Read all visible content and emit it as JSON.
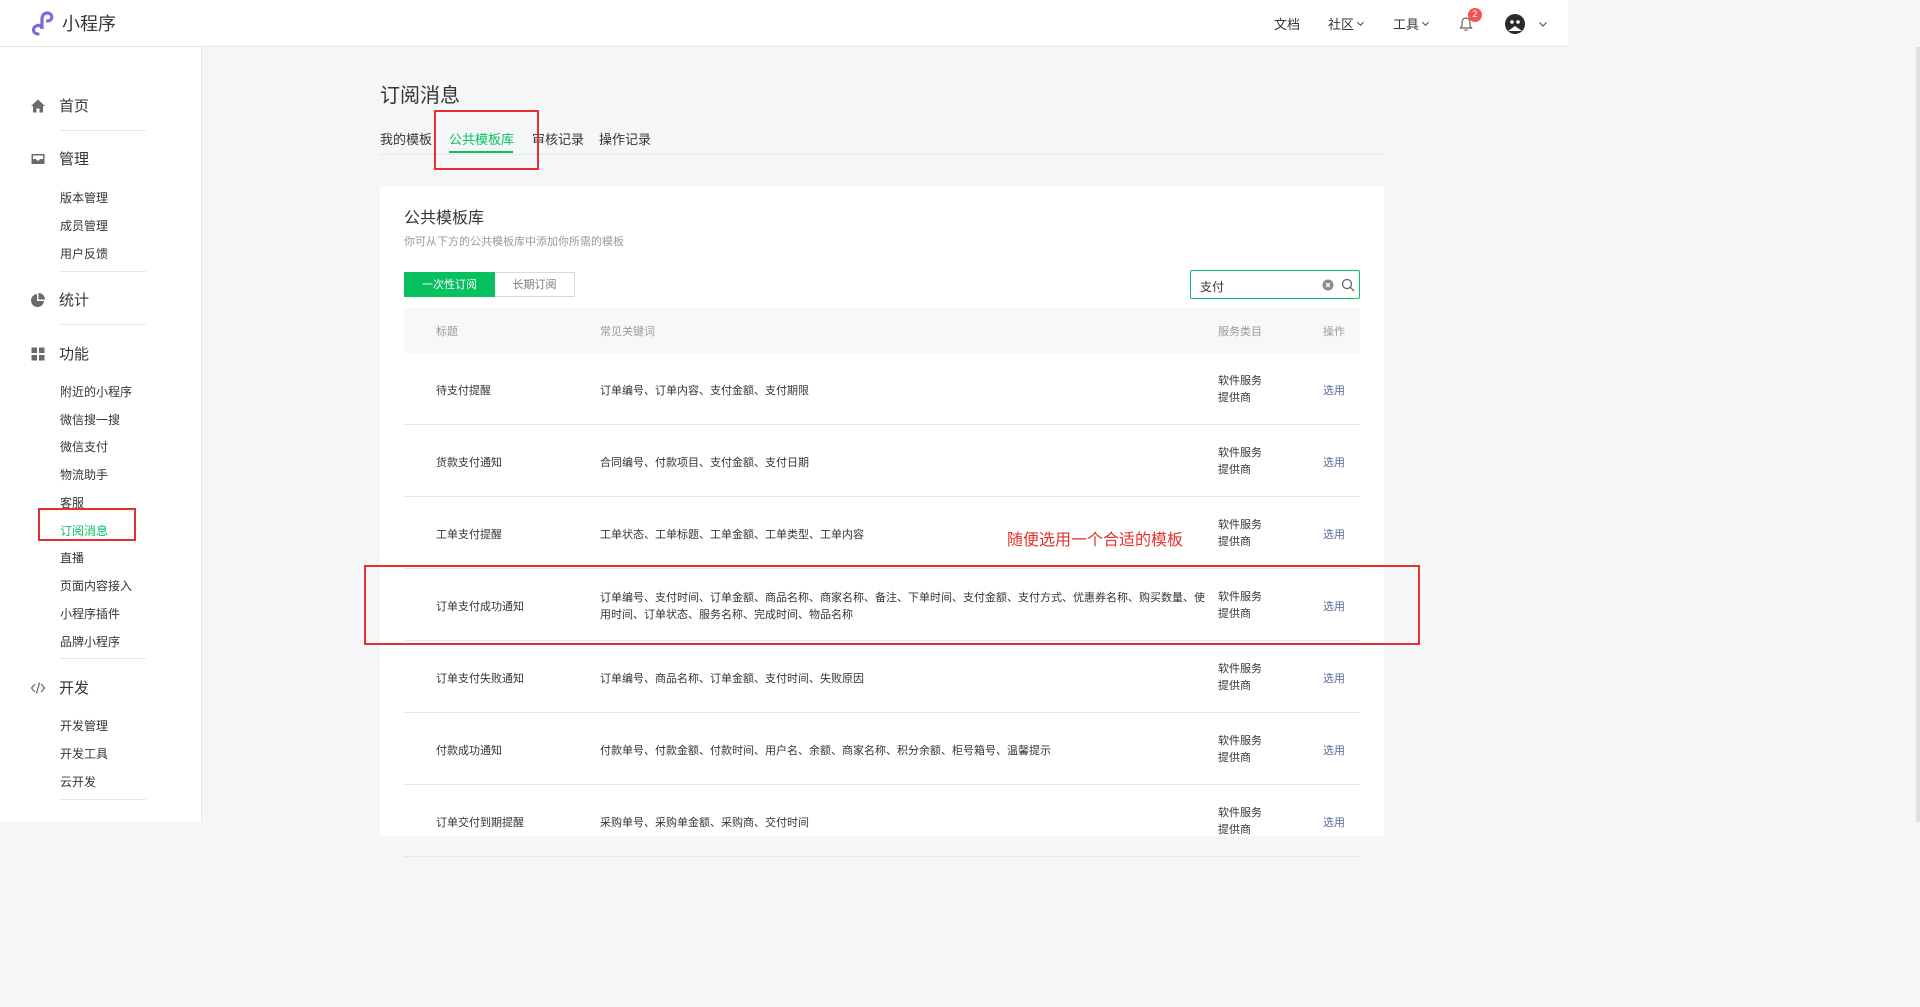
{
  "app": {
    "name": "小程序"
  },
  "topnav": {
    "docs": "文档",
    "community": "社区",
    "tools": "工具",
    "notifications": "2"
  },
  "sidebar": {
    "home": "首页",
    "manage": {
      "label": "管理",
      "items": [
        "版本管理",
        "成员管理",
        "用户反馈"
      ]
    },
    "stats": "统计",
    "features": {
      "label": "功能",
      "items": [
        "附近的小程序",
        "微信搜一搜",
        "微信支付",
        "物流助手",
        "客服",
        "订阅消息",
        "直播",
        "页面内容接入",
        "小程序插件",
        "品牌小程序"
      ],
      "active": "订阅消息"
    },
    "dev": {
      "label": "开发",
      "items": [
        "开发管理",
        "开发工具",
        "云开发"
      ]
    }
  },
  "page": {
    "title": "订阅消息",
    "tabs": [
      "我的模板",
      "公共模板库",
      "审核记录",
      "操作记录"
    ],
    "active_tab": "公共模板库"
  },
  "card": {
    "title": "公共模板库",
    "desc": "你可从下方的公共模板库中添加你所需的模板",
    "segment": [
      "一次性订阅",
      "长期订阅"
    ],
    "search_value": "支付"
  },
  "table": {
    "headers": [
      "标题",
      "常见关键词",
      "服务类目",
      "操作"
    ],
    "rows": [
      {
        "title": "待支付提醒",
        "keywords": [
          "订单编号、订单内容、支付金额、支付期限"
        ],
        "category": [
          "软件服务",
          "提供商"
        ],
        "op": "选用"
      },
      {
        "title": "货款支付通知",
        "keywords": [
          "合同编号、付款项目、支付金额、支付日期"
        ],
        "category": [
          "软件服务",
          "提供商"
        ],
        "op": "选用"
      },
      {
        "title": "工单支付提醒",
        "keywords": [
          "工单状态、工单标题、工单金额、工单类型、工单内容"
        ],
        "category": [
          "软件服务",
          "提供商"
        ],
        "op": "选用"
      },
      {
        "title": "订单支付成功通知",
        "keywords": [
          "订单编号、支付时间、订单金额、商品名称、商家名称、备注、下单时间、支付金额、支付方式、优惠券名称、购买数量、使",
          "用时间、订单状态、服务名称、完成时间、物品名称"
        ],
        "category": [
          "软件服务",
          "提供商"
        ],
        "op": "选用"
      },
      {
        "title": "订单支付失败通知",
        "keywords": [
          "订单编号、商品名称、订单金额、支付时间、失败原因"
        ],
        "category": [
          "软件服务",
          "提供商"
        ],
        "op": "选用"
      },
      {
        "title": "付款成功通知",
        "keywords": [
          "付款单号、付款金额、付款时间、用户名、余额、商家名称、积分余额、柜号箱号、温馨提示"
        ],
        "category": [
          "软件服务",
          "提供商"
        ],
        "op": "选用"
      },
      {
        "title": "订单交付到期提醒",
        "keywords": [
          "采购单号、采购单金额、采购商、交付时间"
        ],
        "category": [
          "软件服务",
          "提供商"
        ],
        "op": "选用"
      }
    ]
  },
  "annotation": "随便选用一个合适的模板",
  "colors": {
    "brand_green": "#07c160",
    "link_blue": "#576b95",
    "annotation_red": "#e5312e",
    "badge_red": "#fa5151"
  }
}
